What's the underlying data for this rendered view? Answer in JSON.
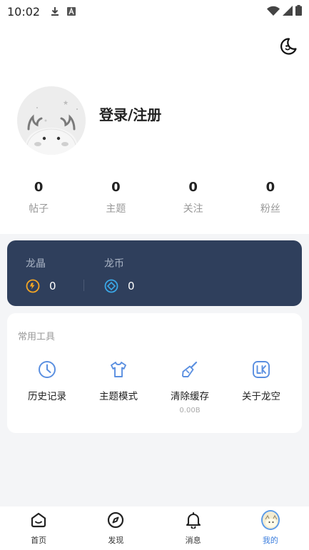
{
  "status_bar": {
    "time": "10:02"
  },
  "profile": {
    "login_label": "登录/注册"
  },
  "stats": [
    {
      "value": "0",
      "label": "帖子"
    },
    {
      "value": "0",
      "label": "主题"
    },
    {
      "value": "0",
      "label": "关注"
    },
    {
      "value": "0",
      "label": "粉丝"
    }
  ],
  "wallet": {
    "crystal": {
      "title": "龙晶",
      "value": "0",
      "color": "#f5a623"
    },
    "coin": {
      "title": "龙币",
      "value": "0",
      "color": "#3aa8e8"
    },
    "background": "#2f3f5c"
  },
  "tools": {
    "title": "常用工具",
    "items": [
      {
        "label": "历史记录",
        "icon": "clock-icon"
      },
      {
        "label": "主题模式",
        "icon": "tshirt-icon"
      },
      {
        "label": "清除缓存",
        "icon": "broom-icon",
        "sub": "0.00B"
      },
      {
        "label": "关于龙空",
        "icon": "lk-logo-icon"
      }
    ],
    "icon_color": "#5a8fe0"
  },
  "tabbar": {
    "items": [
      {
        "label": "首页",
        "icon": "home-icon"
      },
      {
        "label": "发现",
        "icon": "compass-icon"
      },
      {
        "label": "消息",
        "icon": "bell-icon"
      },
      {
        "label": "我的",
        "icon": "avatar-icon",
        "active": true
      }
    ],
    "active_color": "#3b7ddd"
  }
}
